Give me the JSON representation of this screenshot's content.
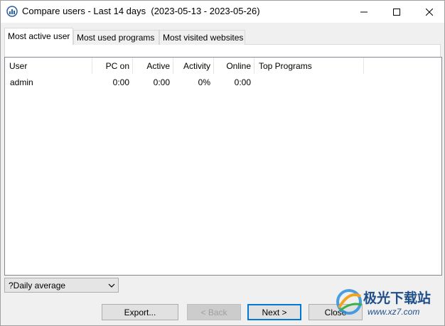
{
  "window": {
    "title": "Compare users - Last 14 days  (2023-05-13 - 2023-05-26)",
    "icon": "bar-chart-app-icon",
    "controls": [
      "minimize-icon",
      "maximize-icon",
      "close-icon"
    ]
  },
  "tabs": [
    {
      "label": "Most active user",
      "active": true
    },
    {
      "label": "Most used programs",
      "active": false
    },
    {
      "label": "Most visited websites",
      "active": false
    }
  ],
  "table": {
    "columns": [
      "User",
      "PC on",
      "Active",
      "Activity",
      "Online",
      "Top Programs"
    ],
    "rows": [
      {
        "user": "admin",
        "pc_on": "0:00",
        "active": "0:00",
        "activity": "0%",
        "online": "0:00",
        "top_programs": ""
      }
    ]
  },
  "period_select": {
    "value": "?Daily average"
  },
  "buttons": {
    "export": "Export...",
    "back": "< Back",
    "next": "Next >",
    "close": "Close"
  },
  "watermark": {
    "text": "极光下载站",
    "url": "www.xz7.com"
  },
  "colors": {
    "accent": "#0078d7",
    "watermark": "#1f4f8a"
  }
}
